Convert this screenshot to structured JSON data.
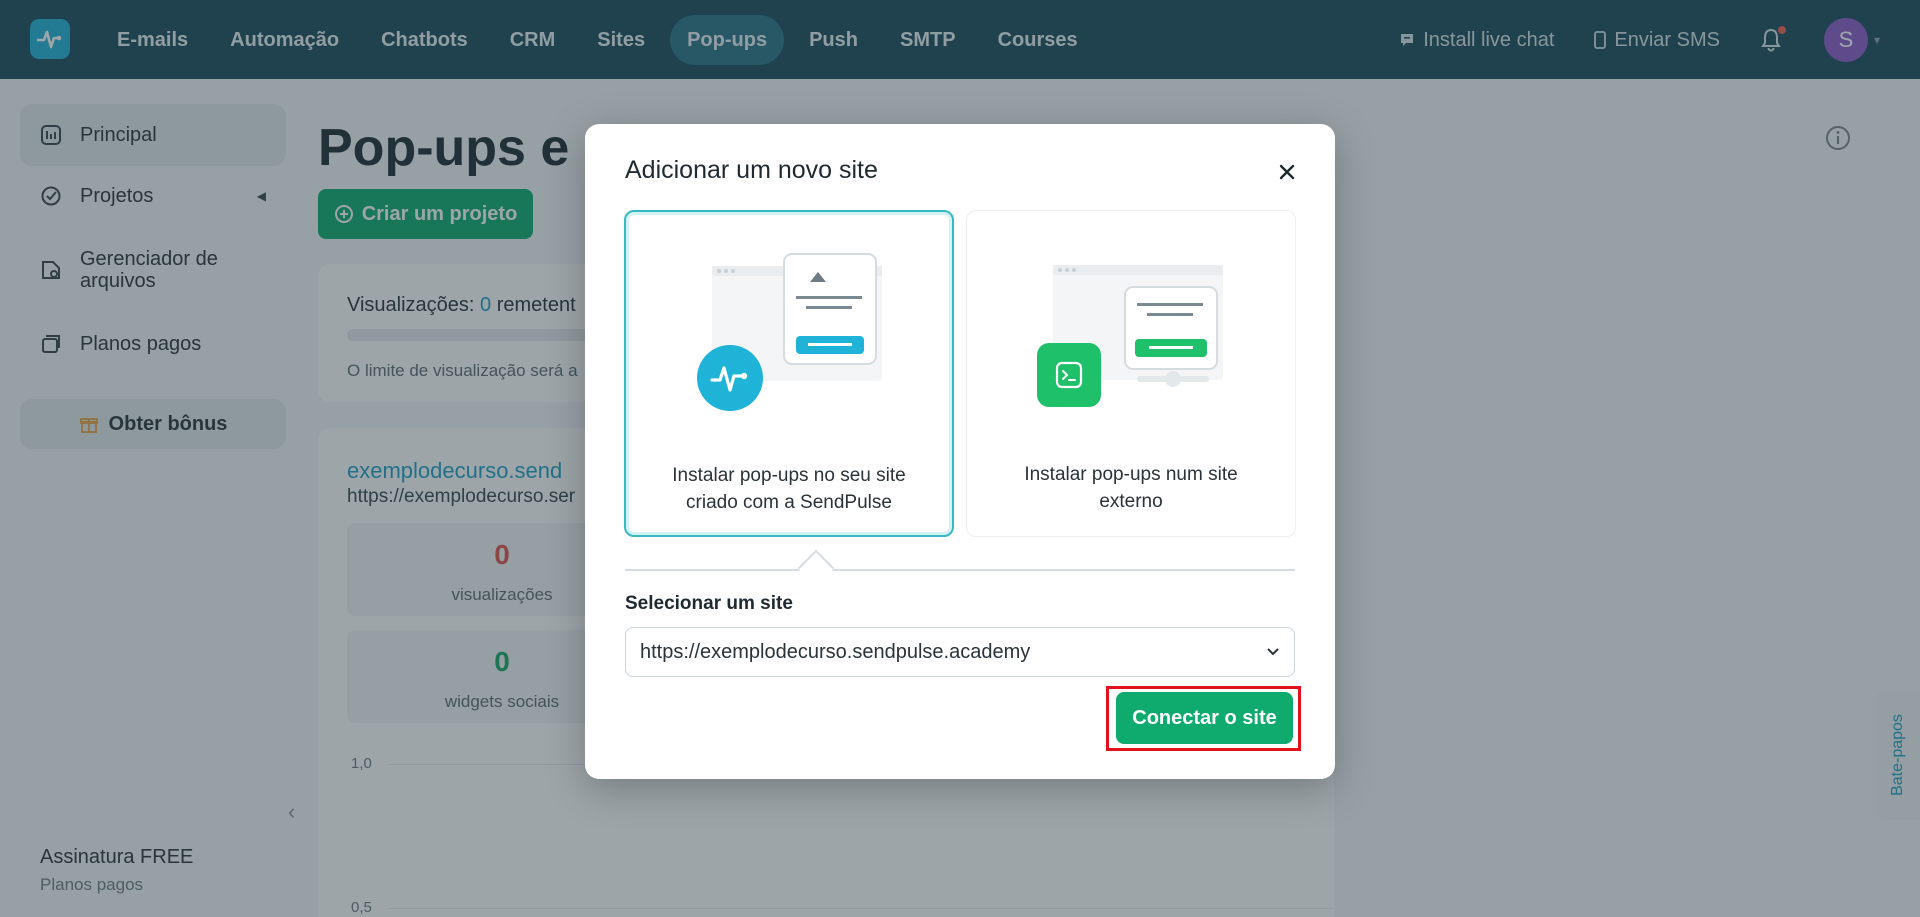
{
  "nav": {
    "items": [
      {
        "label": "E-mails"
      },
      {
        "label": "Automação"
      },
      {
        "label": "Chatbots"
      },
      {
        "label": "CRM"
      },
      {
        "label": "Sites"
      },
      {
        "label": "Pop-ups"
      },
      {
        "label": "Push"
      },
      {
        "label": "SMTP"
      },
      {
        "label": "Courses"
      }
    ],
    "active": "Pop-ups",
    "live_chat": "Install live chat",
    "sms": "Enviar SMS",
    "avatar_letter": "S"
  },
  "sidebar": {
    "items": [
      {
        "label": "Principal",
        "icon": "dashboard-icon"
      },
      {
        "label": "Projetos",
        "icon": "projects-icon"
      },
      {
        "label": "Gerenciador de arquivos",
        "icon": "file-manager-icon"
      },
      {
        "label": "Planos pagos",
        "icon": "paid-plans-icon"
      }
    ],
    "bonus": "Obter bônus",
    "plan_name": "Assinatura FREE",
    "plan_link": "Planos pagos"
  },
  "main": {
    "title": "Pop-ups e g",
    "create_button": "Criar um projeto",
    "views_label": "Visualizações:",
    "views_value": "0",
    "views_suffix": "remetent",
    "limit_note": "O limite de visualização será a",
    "site_name": "exemplodecurso.send",
    "site_url": "https://exemplodecurso.ser",
    "stats": [
      {
        "value": "0",
        "label": "visualizações",
        "color": "#e0524a"
      },
      {
        "value": "0",
        "label": "widgets sociais",
        "color": "#19a866"
      }
    ],
    "y_ticks": [
      "1,0",
      "0,5"
    ]
  },
  "chat_tab": "Bate-papos",
  "modal": {
    "title": "Adicionar um novo site",
    "options": [
      {
        "line1": "Instalar pop-ups no seu site",
        "line2": "criado com a SendPulse",
        "selected": true
      },
      {
        "line1": "Instalar pop-ups num site",
        "line2": "externo",
        "selected": false
      }
    ],
    "select_label": "Selecionar um site",
    "select_value": "https://exemplodecurso.sendpulse.academy",
    "connect_button": "Conectar o site"
  },
  "colors": {
    "nav_bg": "#1d4a5a",
    "accent_green": "#0fab6e",
    "accent_blue": "#1ea1c6",
    "highlight_red": "#e3101d"
  }
}
